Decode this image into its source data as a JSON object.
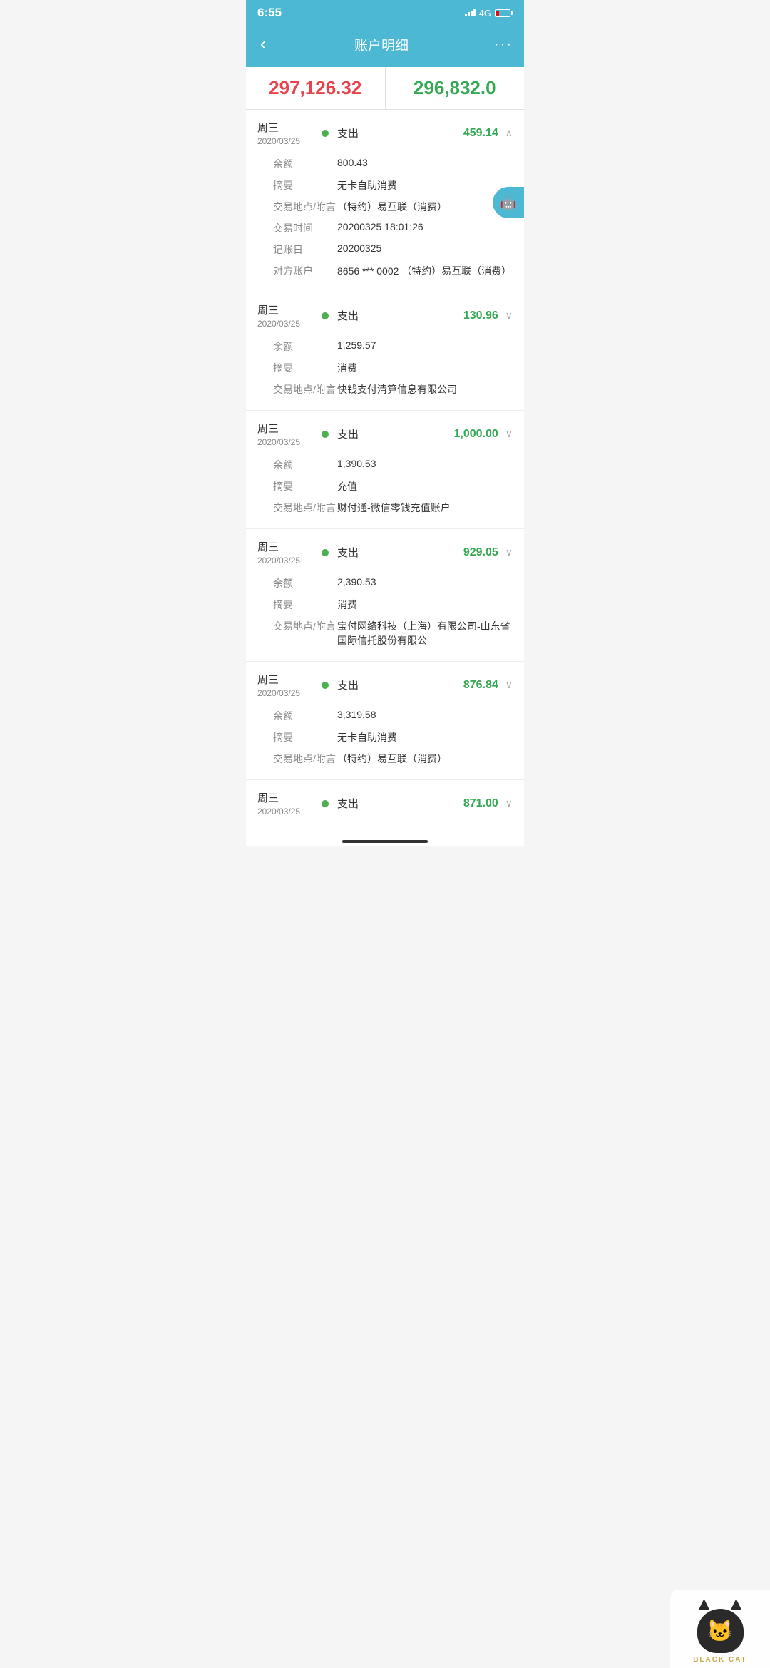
{
  "statusBar": {
    "time": "6:55",
    "signal": "4G",
    "battery_low": true
  },
  "header": {
    "back_label": "‹",
    "title": "账户明细",
    "more_label": "···"
  },
  "balances": {
    "left_amount": "297,126.32",
    "right_amount": "296,832.0",
    "robot_label": "🤖"
  },
  "transactions": [
    {
      "day": "周三",
      "date": "2020/03/25",
      "dot_color": "#4caf50",
      "type": "支出",
      "amount": "459.14",
      "amount_color": "green",
      "expanded": true,
      "chevron": "∧",
      "details": [
        {
          "label": "余额",
          "value": "800.43"
        },
        {
          "label": "摘要",
          "value": "无卡自助消费"
        },
        {
          "label": "交易地点/附言",
          "value": "（特约）易互联（消费）"
        },
        {
          "label": "交易时间",
          "value": "20200325 18:01:26"
        },
        {
          "label": "记账日",
          "value": "20200325"
        },
        {
          "label": "对方账户",
          "value": "8656 *** 0002 （特约）易互联（消费）"
        }
      ]
    },
    {
      "day": "周三",
      "date": "2020/03/25",
      "dot_color": "#4caf50",
      "type": "支出",
      "amount": "130.96",
      "amount_color": "green",
      "expanded": true,
      "chevron": "∨",
      "details": [
        {
          "label": "余额",
          "value": "1,259.57"
        },
        {
          "label": "摘要",
          "value": "消费"
        },
        {
          "label": "交易地点/附言",
          "value": "快钱支付清算信息有限公司"
        }
      ]
    },
    {
      "day": "周三",
      "date": "2020/03/25",
      "dot_color": "#4caf50",
      "type": "支出",
      "amount": "1,000.00",
      "amount_color": "green",
      "expanded": true,
      "chevron": "∨",
      "details": [
        {
          "label": "余额",
          "value": "1,390.53"
        },
        {
          "label": "摘要",
          "value": "充值"
        },
        {
          "label": "交易地点/附言",
          "value": "财付通-微信零钱充值账户"
        }
      ]
    },
    {
      "day": "周三",
      "date": "2020/03/25",
      "dot_color": "#4caf50",
      "type": "支出",
      "amount": "929.05",
      "amount_color": "green",
      "expanded": true,
      "chevron": "∨",
      "details": [
        {
          "label": "余额",
          "value": "2,390.53"
        },
        {
          "label": "摘要",
          "value": "消费"
        },
        {
          "label": "交易地点/附言",
          "value": "宝付网络科技（上海）有限公司-山东省国际信托股份有限公"
        }
      ]
    },
    {
      "day": "周三",
      "date": "2020/03/25",
      "dot_color": "#4caf50",
      "type": "支出",
      "amount": "876.84",
      "amount_color": "green",
      "expanded": true,
      "chevron": "∨",
      "details": [
        {
          "label": "余额",
          "value": "3,319.58"
        },
        {
          "label": "摘要",
          "value": "无卡自助消费"
        },
        {
          "label": "交易地点/附言",
          "value": "（特约）易互联（消费）"
        }
      ]
    },
    {
      "day": "周三",
      "date": "2020/03/25",
      "dot_color": "#4caf50",
      "type": "支出",
      "amount": "871.00",
      "amount_color": "green",
      "expanded": false,
      "chevron": "∨",
      "details": []
    }
  ],
  "blackCat": {
    "label": "BLACK CAT"
  }
}
